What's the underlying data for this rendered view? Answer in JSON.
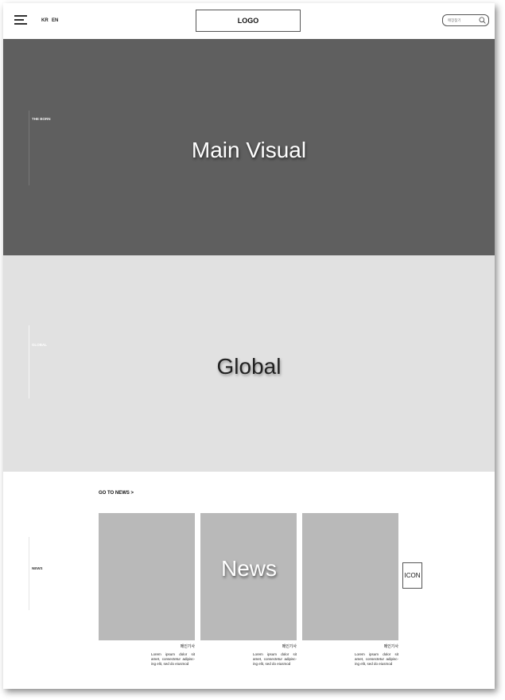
{
  "header": {
    "lang_kr": "KR",
    "lang_en": "EN",
    "logo": "LOGO",
    "search_placeholder": "매장찾기"
  },
  "main_visual": {
    "side_label": "THE BORN",
    "title": "Main Visual"
  },
  "global": {
    "side_label": "GLOBAL",
    "title": "Global"
  },
  "news": {
    "side_label": "NEWS",
    "go_to": "GO TO NEWS >",
    "title": "News",
    "icon_label": "ICON",
    "cards": [
      {
        "title": "메인기사",
        "desc": "Lorem ipsum dolor sit amet, consectetur adipisc-ing elit, sed do eiusmod"
      },
      {
        "title": "메인기사",
        "desc": "Lorem ipsum dolor sit amet, consectetur adipisc-ing elit, sed do eiusmod"
      },
      {
        "title": "메인기사",
        "desc": "Lorem ipsum dolor sit amet, consectetur adipisc-ing elit, sed do eiusmod"
      }
    ]
  },
  "colors": {
    "main_visual_bg": "#5f5f5f",
    "global_bg": "#e1e1e1",
    "card_bg": "#b9b9b9"
  }
}
